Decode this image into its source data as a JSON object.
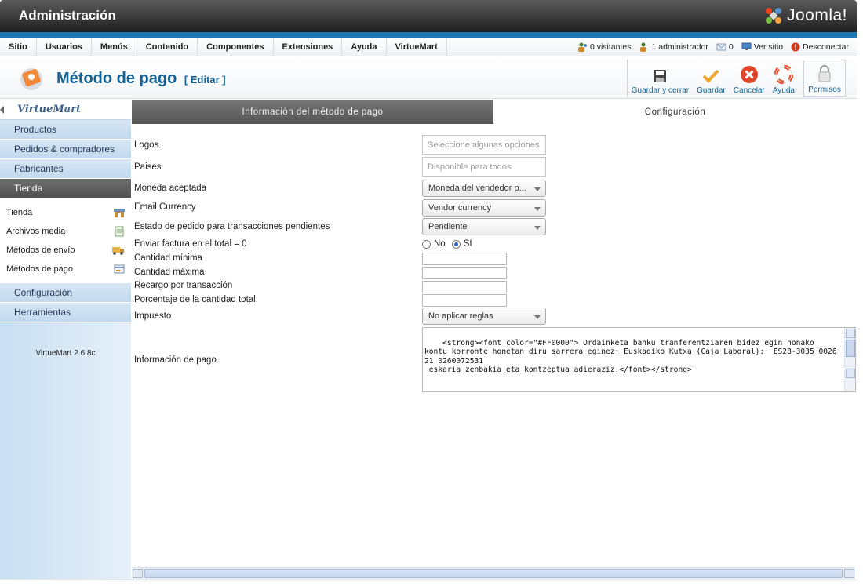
{
  "header": {
    "title": "Administración",
    "logo_text": "Joomla!"
  },
  "menu": {
    "items": [
      "Sitio",
      "Usuarios",
      "Menús",
      "Contenido",
      "Componentes",
      "Extensiones",
      "Ayuda",
      "VirtueMart"
    ],
    "status": {
      "visitors": "0 visitantes",
      "admins": "1 administrador",
      "messages": "0",
      "view_site": "Ver sitio",
      "logout": "Desconectar"
    }
  },
  "page": {
    "title": "Método de pago",
    "subtitle": "[ Editar ]"
  },
  "toolbar": {
    "save_close": "Guardar y cerrar",
    "save": "Guardar",
    "cancel": "Cancelar",
    "help": "Ayuda",
    "permissions": "Permisos"
  },
  "sidebar": {
    "logo": "VirtueMart",
    "items": [
      "Productos",
      "Pedidos & compradores",
      "Fabricantes",
      "Tienda"
    ],
    "sub_items": [
      "Tienda",
      "Archivos media",
      "Métodos de envío",
      "Métodos de pago"
    ],
    "items_bottom": [
      "Configuración",
      "Herramientas"
    ],
    "version": "VirtueMart 2.6.8c"
  },
  "tabs": {
    "info": "Información del método de pago",
    "config": "Configuración"
  },
  "form": {
    "logos": {
      "label": "Logos",
      "placeholder": "Seleccione algunas opciones"
    },
    "countries": {
      "label": "Paises",
      "placeholder": "Disponible para todos"
    },
    "currency": {
      "label": "Moneda aceptada",
      "value": "Moneda del vendedor p..."
    },
    "email_currency": {
      "label": "Email Currency",
      "value": "Vendor currency"
    },
    "pending_status": {
      "label": "Estado de pedido para transacciones pendientes",
      "value": "Pendiente"
    },
    "invoice": {
      "label": "Enviar factura en el total = 0",
      "option_no": "No",
      "option_yes": "SI"
    },
    "min_amount": {
      "label": "Cantidad mínima"
    },
    "max_amount": {
      "label": "Cantidad máxima"
    },
    "fee": {
      "label": "Recargo por transacción"
    },
    "percent": {
      "label": "Porcentaje de la cantidad total"
    },
    "tax": {
      "label": "Impuesto",
      "value": "No aplicar reglas"
    },
    "payment_info": {
      "label": "Información de pago",
      "value": "<strong><font color=\"#FF0000\"> Ordainketa banku tranferentziaren bidez egin honako kontu korronte honetan diru sarrera eginez: Euskadiko Kutxa (Caja Laboral):  ES28-3035 0026 21 0260072531\n eskaria zenbakia eta kontzeptua adieraziz.</font></strong>"
    }
  },
  "colors": {
    "accent": "#146295",
    "brand_strip": "#1c79b5",
    "cancel": "#e0452a",
    "save": "#f0a32a"
  }
}
